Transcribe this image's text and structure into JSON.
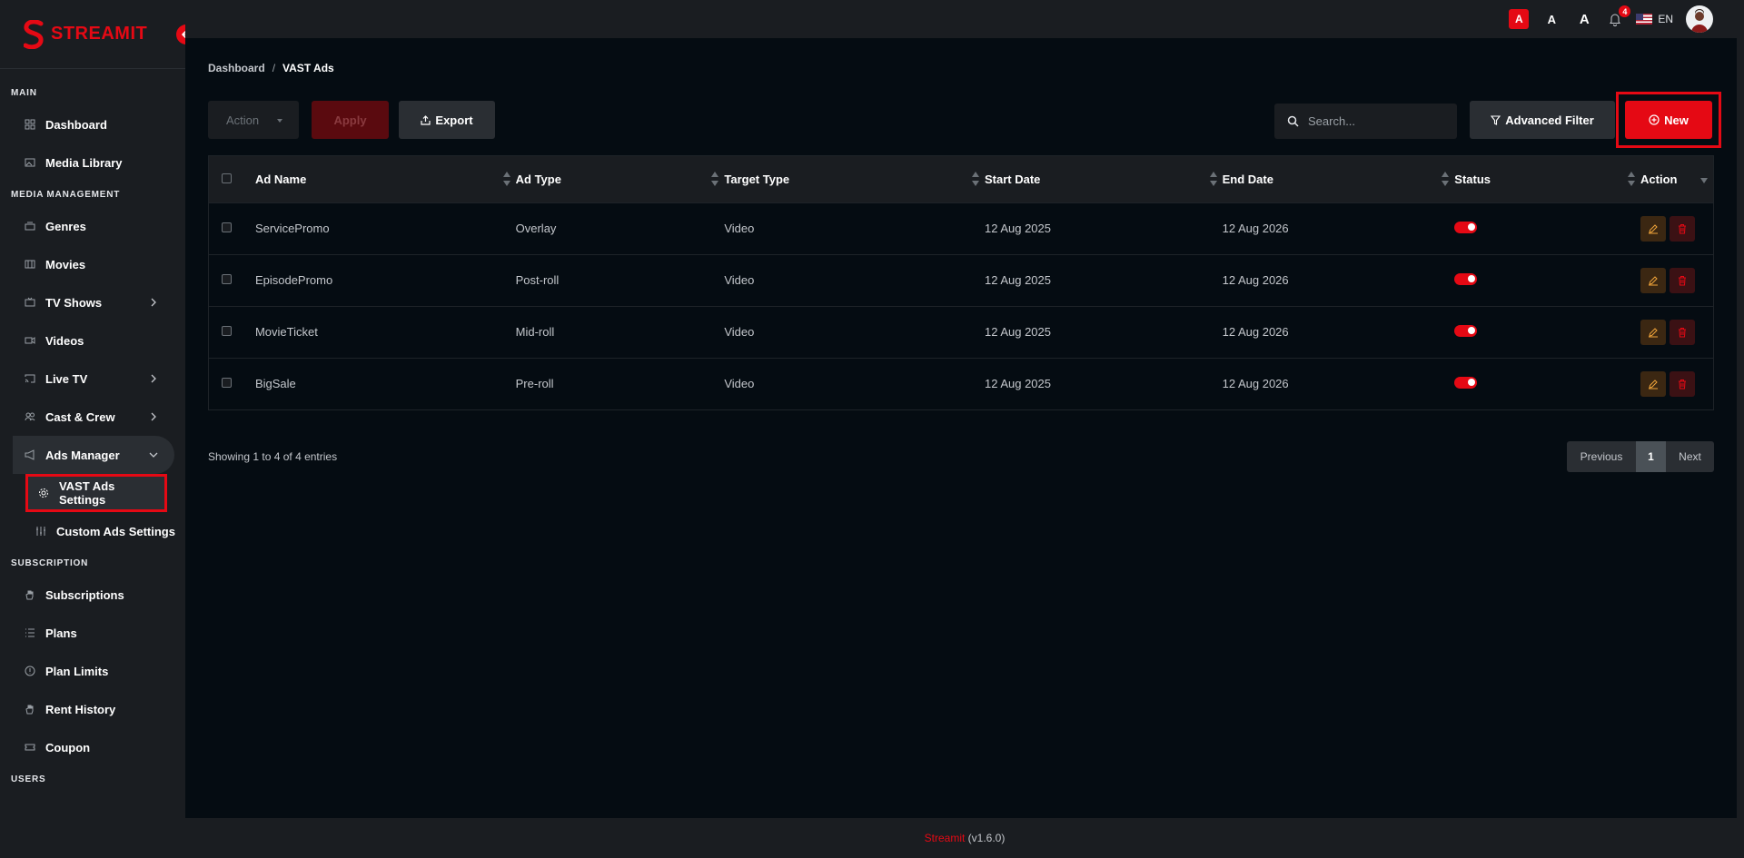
{
  "brand": {
    "name": "STREAMIT",
    "accent": "#e50914"
  },
  "sidebar": {
    "sections": [
      {
        "label": "MAIN",
        "items": [
          {
            "label": "Dashboard",
            "icon": "dashboard-icon"
          },
          {
            "label": "Media Library",
            "icon": "image-icon"
          }
        ]
      },
      {
        "label": "MEDIA MANAGEMENT",
        "items": [
          {
            "label": "Genres",
            "icon": "genres-icon"
          },
          {
            "label": "Movies",
            "icon": "movie-icon"
          },
          {
            "label": "TV Shows",
            "icon": "tv-icon",
            "expandable": true
          },
          {
            "label": "Videos",
            "icon": "video-icon"
          },
          {
            "label": "Live TV",
            "icon": "cast-icon",
            "expandable": true
          },
          {
            "label": "Cast & Crew",
            "icon": "users-icon",
            "expandable": true
          },
          {
            "label": "Ads Manager",
            "icon": "megaphone-icon",
            "expanded": true,
            "children": [
              {
                "label": "VAST Ads Settings",
                "icon": "gear-icon",
                "active": true
              },
              {
                "label": "Custom Ads Settings",
                "icon": "sliders-icon"
              }
            ]
          }
        ]
      },
      {
        "label": "SUBSCRIPTION",
        "items": [
          {
            "label": "Subscriptions",
            "icon": "hand-icon"
          },
          {
            "label": "Plans",
            "icon": "list-icon"
          },
          {
            "label": "Plan Limits",
            "icon": "alert-circle-icon"
          },
          {
            "label": "Rent History",
            "icon": "hand-icon"
          },
          {
            "label": "Coupon",
            "icon": "ticket-icon"
          }
        ]
      },
      {
        "label": "USERS",
        "items": []
      }
    ]
  },
  "topbar": {
    "font_sizes": [
      "A",
      "A",
      "A"
    ],
    "notifications_count": "4",
    "language": "EN"
  },
  "breadcrumb": {
    "parent": "Dashboard",
    "separator": "/",
    "current": "VAST Ads"
  },
  "toolbar": {
    "action_placeholder": "Action",
    "apply_label": "Apply",
    "export_label": "Export",
    "search_placeholder": "Search...",
    "advanced_filter_label": "Advanced Filter",
    "new_label": "New"
  },
  "table": {
    "columns": [
      "Ad Name",
      "Ad Type",
      "Target Type",
      "Start Date",
      "End Date",
      "Status",
      "Action"
    ],
    "rows": [
      {
        "ad_name": "ServicePromo",
        "ad_type": "Overlay",
        "target_type": "Video",
        "start_date": "12 Aug 2025",
        "end_date": "12 Aug 2026",
        "status": true
      },
      {
        "ad_name": "EpisodePromo",
        "ad_type": "Post-roll",
        "target_type": "Video",
        "start_date": "12 Aug 2025",
        "end_date": "12 Aug 2026",
        "status": true
      },
      {
        "ad_name": "MovieTicket",
        "ad_type": "Mid-roll",
        "target_type": "Video",
        "start_date": "12 Aug 2025",
        "end_date": "12 Aug 2026",
        "status": true
      },
      {
        "ad_name": "BigSale",
        "ad_type": "Pre-roll",
        "target_type": "Video",
        "start_date": "12 Aug 2025",
        "end_date": "12 Aug 2026",
        "status": true
      }
    ]
  },
  "pagination": {
    "summary": "Showing 1 to 4 of 4 entries",
    "previous": "Previous",
    "current_page": "1",
    "next": "Next"
  },
  "footer": {
    "brand": "Streamit",
    "version": " (v1.6.0)"
  }
}
